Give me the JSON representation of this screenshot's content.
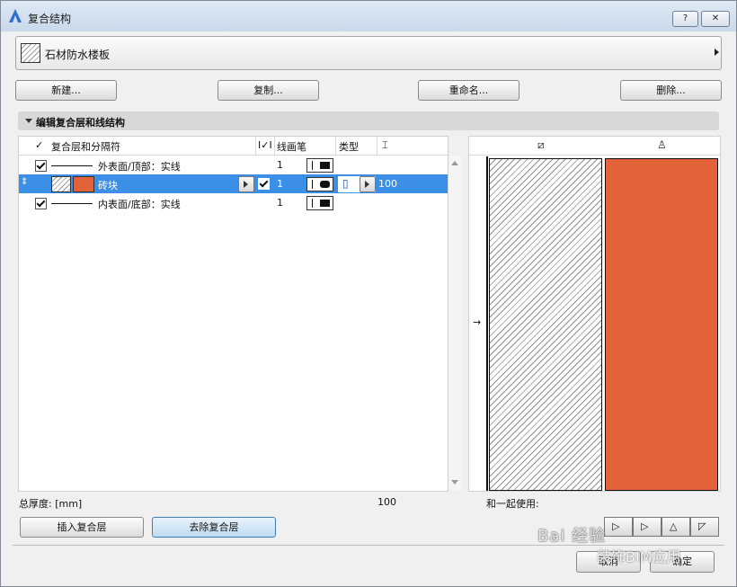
{
  "window": {
    "title": "复合结构",
    "help_label": "?",
    "close_label": "✕"
  },
  "composite": {
    "selected_name": "石材防水楼板"
  },
  "actions": {
    "new": "新建...",
    "duplicate": "复制...",
    "rename": "重命名...",
    "delete": "删除..."
  },
  "section": {
    "title": "编辑复合层和线结构"
  },
  "table": {
    "headers": {
      "check": "✓",
      "layers": "复合层和分隔符",
      "pen_check": "I✓I",
      "line_pen": "线画笔",
      "type": "类型",
      "thickness": "⌶"
    },
    "rows": [
      {
        "kind": "line",
        "checked": true,
        "label": "外表面/顶部：实线",
        "pen": "1"
      },
      {
        "kind": "layer",
        "selected": true,
        "label": "砖块",
        "pen": "1",
        "thickness": "100",
        "fill_color": "#e2623a"
      },
      {
        "kind": "line",
        "checked": true,
        "label": "内表面/底部：实线",
        "pen": "1"
      }
    ]
  },
  "footer": {
    "total_label": "总厚度: [mm]",
    "total_value": "100",
    "insert_layer": "插入复合层",
    "remove_layer": "去除复合层",
    "use_with": "和一起使用:"
  },
  "preview": {
    "layer_fill": "#e2623a",
    "icons": [
      "fill-pattern-icon",
      "paint-brush-icon"
    ],
    "arrow": "→"
  },
  "bottom": {
    "cancel": "取消",
    "ok": "确定"
  },
  "watermark": {
    "line1": "Bai 经验",
    "line2": "装饰BIM应用"
  }
}
